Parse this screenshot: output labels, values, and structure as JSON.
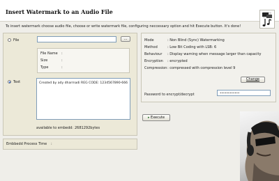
{
  "header": {
    "title": "Insert Watermark to an Audio File",
    "instructions": "To insert watermark choose audio file, choose or write watermark file, configuring neccessary option and hit Execute button. It's done!"
  },
  "source": {
    "file_label": "File",
    "file_value": "",
    "browse_label": "...",
    "file_name_label": "File Name",
    "size_label": "Size",
    "type_label": "Type",
    "sep": ":",
    "text_label": "Text",
    "text_value": "Created by ady dharmadi REG CODE: 1234567890-666",
    "available_label": "available to embedd:",
    "available_value": "2681292bytes",
    "selected": "text"
  },
  "settings": {
    "rows": [
      {
        "label": "Mode",
        "value": "Non Blind (Sync) Watermarking"
      },
      {
        "label": "Method",
        "value": "Low Bit Coding with LSB: 6"
      },
      {
        "label": "Behaviour",
        "value": "Display warning when message larger than capacity"
      },
      {
        "label": "Encryption",
        "value": "encrypted"
      },
      {
        "label": "Compression",
        "value": "compressed with compression level 9"
      }
    ],
    "change_label": "Change",
    "password_label": "Password to encrypt/decrypt",
    "password_value": "••••••••••••"
  },
  "actions": {
    "execute_label": "Execute"
  },
  "status": {
    "process_time_label": "Embbedd Process Time",
    "sep": ":",
    "process_time_value": ""
  },
  "colors": {
    "accent": "#1e5bd6",
    "panel": "#ece9d8"
  }
}
